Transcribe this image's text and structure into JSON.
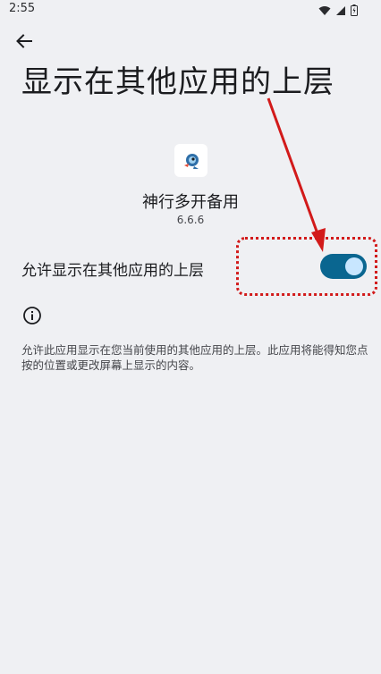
{
  "status_bar": {
    "time": "2:55"
  },
  "header": {
    "back_icon": "arrow-back-icon",
    "title": "显示在其他应用的上层"
  },
  "app": {
    "icon": "app-logo-icon",
    "name": "神行多开备用",
    "version": "6.6.6"
  },
  "permission": {
    "toggle_label": "允许显示在其他应用的上层",
    "toggle_state": "on"
  },
  "info": {
    "icon": "info-icon",
    "description": "允许此应用显示在您当前使用的其他应用的上层。此应用将能得知您点按的位置或更改屏幕上显示的内容。"
  },
  "colors": {
    "background": "#eff0f3",
    "switch_track": "#0a6690",
    "switch_thumb": "#c8e6ff",
    "annotation": "#d21a1a"
  }
}
